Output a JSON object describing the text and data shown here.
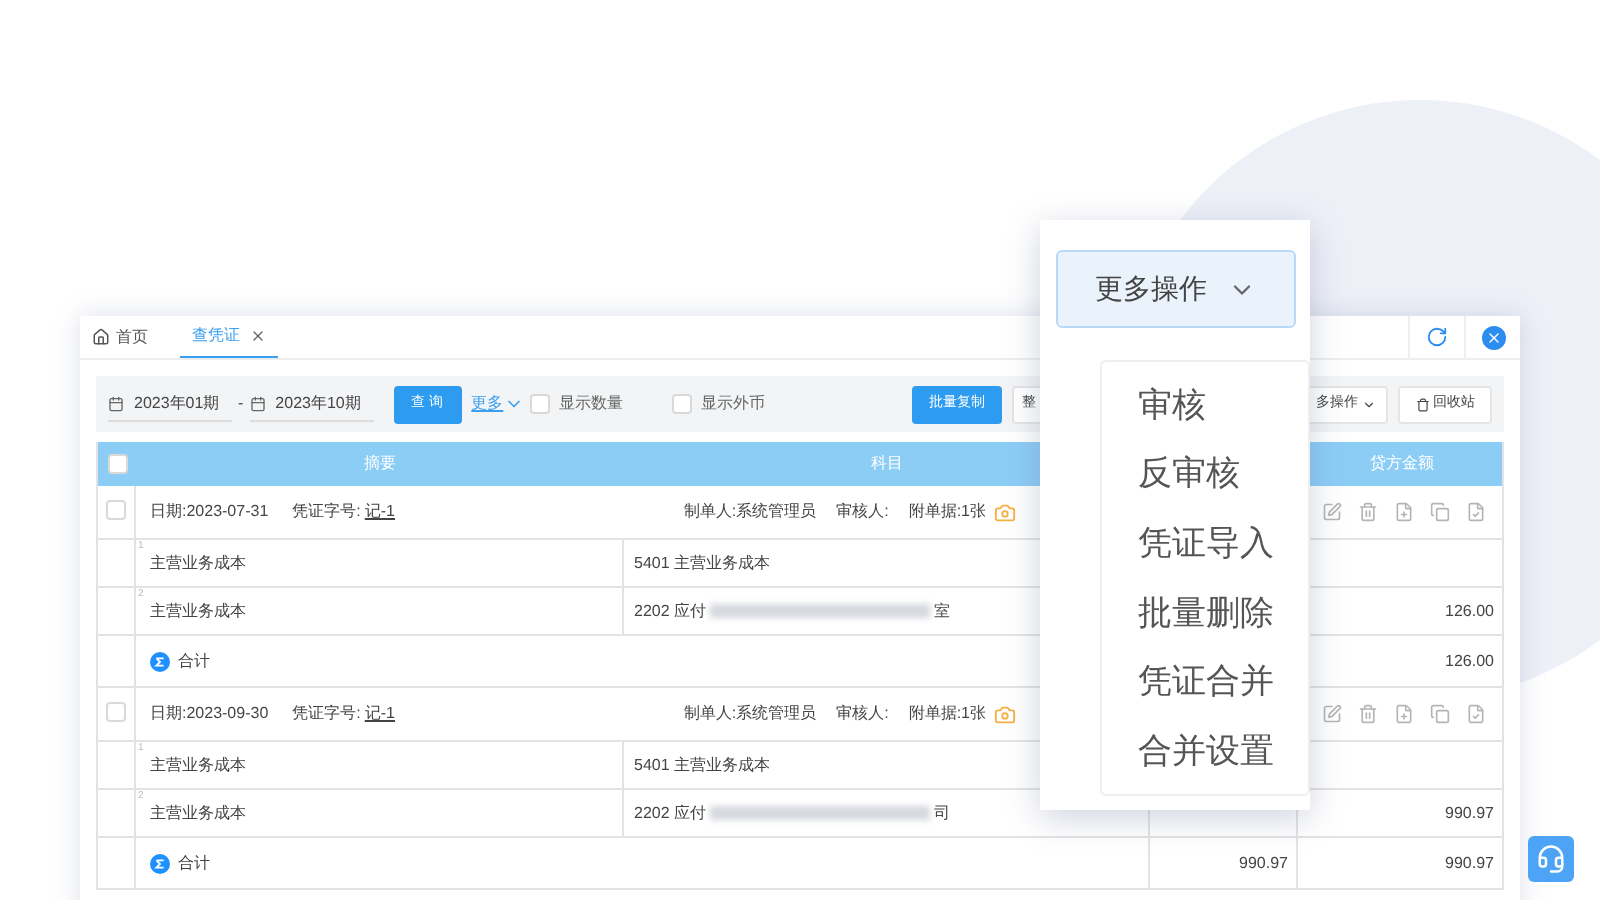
{
  "tabs": [
    {
      "label": "首页",
      "kind": "home",
      "selected": false
    },
    {
      "label": "查凭证",
      "kind": "page",
      "selected": true
    }
  ],
  "toolbar": {
    "period_from": "2023年01期",
    "period_separator": "-",
    "period_to": "2023年10期",
    "query_button": "查 询",
    "more_link": "更多",
    "options": [
      {
        "label": "显示数量",
        "checked": false
      },
      {
        "label": "显示外币",
        "checked": false
      }
    ],
    "buttons": [
      {
        "label": "批量复制",
        "kind": "primary"
      },
      {
        "label": "整",
        "kind": "plain"
      },
      {
        "label": "多操作",
        "kind": "menu"
      },
      {
        "label": "回收站",
        "kind": "trash"
      }
    ]
  },
  "table": {
    "select_all_checked": false,
    "columns": [
      {
        "label": "摘要"
      },
      {
        "label": "科目"
      },
      {
        "label": "贷方金额"
      }
    ],
    "vouchers": [
      {
        "checked": false,
        "date": "日期:2023-07-31",
        "number_label": "凭证字号:",
        "number": "记-1",
        "maker": "制单人:系统管理员",
        "auditor": "审核人:",
        "attachments": "附单据:1张",
        "lines": [
          {
            "index": "1",
            "summary": "主营业务成本",
            "account": "5401 主营业务成本"
          },
          {
            "index": "2",
            "summary": "主营业务成本",
            "account": "2202 应付",
            "account_blurred": true,
            "account_end": "室",
            "credit": "126.00"
          }
        ],
        "total": {
          "label": "合计",
          "credit": "126.00"
        }
      },
      {
        "checked": false,
        "date": "日期:2023-09-30",
        "number_label": "凭证字号:",
        "number": "记-1",
        "maker": "制单人:系统管理员",
        "auditor": "审核人:",
        "attachments": "附单据:1张",
        "lines": [
          {
            "index": "1",
            "summary": "主营业务成本",
            "account": "5401 主营业务成本"
          },
          {
            "index": "2",
            "summary": "主营业务成本",
            "account": "2202 应付",
            "account_blurred": true,
            "account_end": "司",
            "credit": "990.97"
          }
        ],
        "total": {
          "label": "合计",
          "debit": "990.97",
          "credit": "990.97"
        }
      }
    ]
  },
  "more_menu": {
    "button": "更多操作",
    "expanded": true,
    "items": [
      "审核",
      "反审核",
      "凭证导入",
      "批量删除",
      "凭证合并",
      "合并设置"
    ]
  }
}
